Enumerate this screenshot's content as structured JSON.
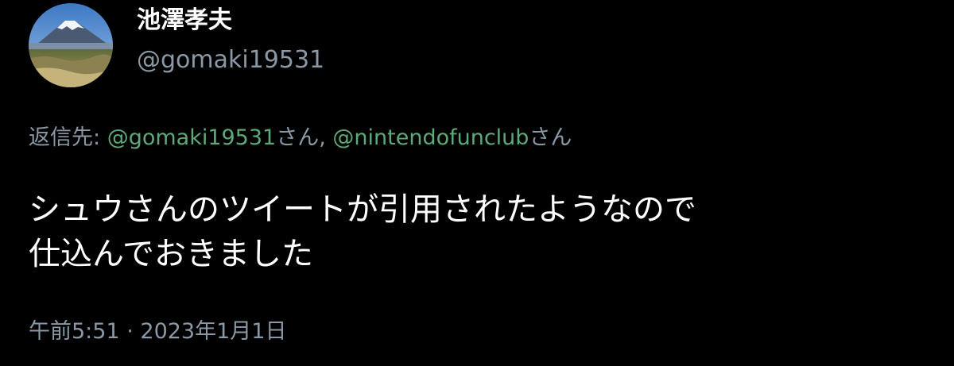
{
  "author": {
    "display_name": "池澤孝夫",
    "handle": "@gomaki19531",
    "avatar_icon": "mount-fuji-landscape-avatar"
  },
  "reply": {
    "prefix": "返信先: ",
    "mentions": [
      {
        "handle": "@gomaki19531",
        "suffix": "さん"
      },
      {
        "handle": "@nintendofunclub",
        "suffix": "さん"
      }
    ],
    "separator": ", "
  },
  "tweet": {
    "lines": [
      "シュウさんのツイートが引用されたようなので",
      "仕込んでおきました"
    ]
  },
  "meta": {
    "time": "午前5:51",
    "dot": " · ",
    "date": "2023年1月1日"
  },
  "colors": {
    "background": "#000000",
    "text": "#ffffff",
    "secondary": "#8b98a5",
    "mention": "#5ea87a"
  }
}
